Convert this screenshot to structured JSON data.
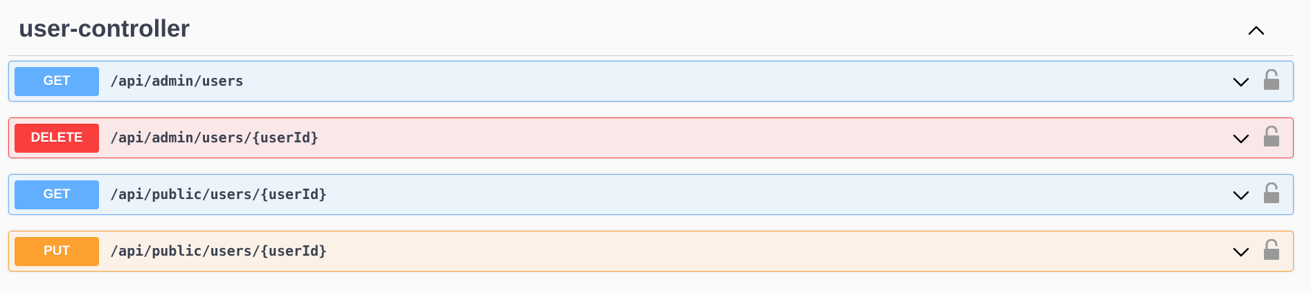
{
  "tag": {
    "title": "user-controller"
  },
  "operations": [
    {
      "method": "GET",
      "path": "/api/admin/users",
      "kind": "get"
    },
    {
      "method": "DELETE",
      "path": "/api/admin/users/{userId}",
      "kind": "delete"
    },
    {
      "method": "GET",
      "path": "/api/public/users/{userId}",
      "kind": "get"
    },
    {
      "method": "PUT",
      "path": "/api/public/users/{userId}",
      "kind": "put"
    }
  ],
  "colors": {
    "get": "#61affe",
    "delete": "#f93e3e",
    "put": "#fca130",
    "text": "#3b4151"
  },
  "icons": {
    "collapse": "chevron-up-icon",
    "expand": "chevron-down-icon",
    "lock": "lock-icon"
  }
}
